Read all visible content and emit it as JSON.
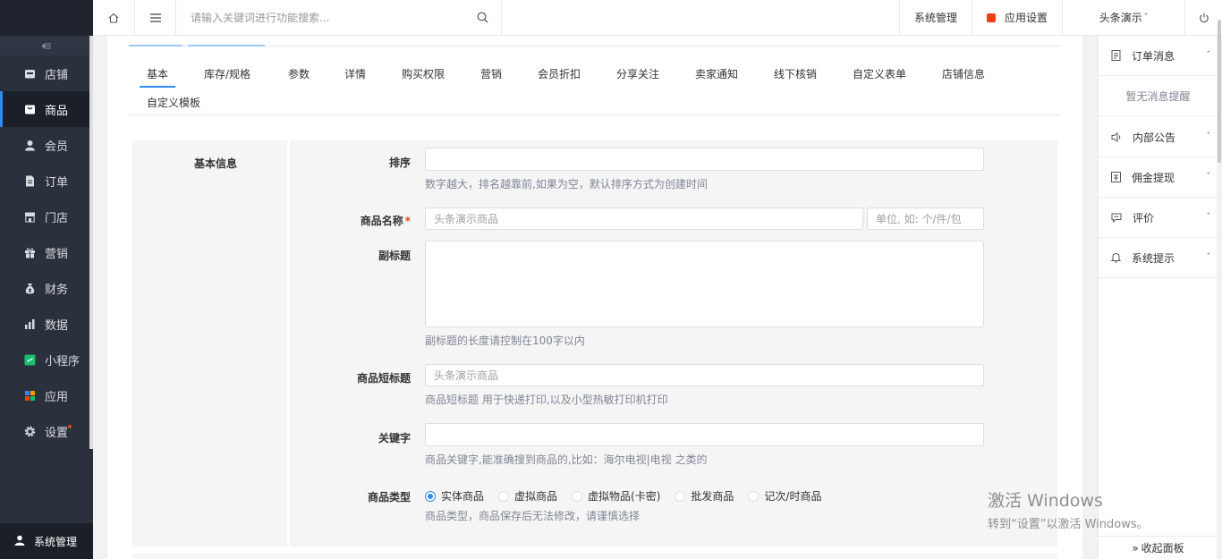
{
  "sidebar": {
    "items": [
      {
        "label": "店铺",
        "icon": "shop-icon"
      },
      {
        "label": "商品",
        "icon": "goods-icon"
      },
      {
        "label": "会员",
        "icon": "user-icon"
      },
      {
        "label": "订单",
        "icon": "order-icon"
      },
      {
        "label": "门店",
        "icon": "store-icon"
      },
      {
        "label": "营销",
        "icon": "gift-icon"
      },
      {
        "label": "财务",
        "icon": "money-bag-icon"
      },
      {
        "label": "数据",
        "icon": "bar-chart-icon"
      },
      {
        "label": "小程序",
        "icon": "miniprogram-icon"
      },
      {
        "label": "应用",
        "icon": "apps-icon"
      },
      {
        "label": "设置",
        "icon": "gear-icon"
      }
    ],
    "active_index": 1,
    "footer_label": "系统管理"
  },
  "topbar": {
    "search_placeholder": "请输入关键词进行功能搜索...",
    "system_label": "系统管理",
    "app_settings_label": "应用设置",
    "user_label": "头条演示"
  },
  "tabs": [
    "基本",
    "库存/规格",
    "参数",
    "详情",
    "购买权限",
    "营销",
    "会员折扣",
    "分享关注",
    "卖家通知",
    "线下核销",
    "自定义表单",
    "店铺信息",
    "自定义模板"
  ],
  "form": {
    "section_title": "基本信息",
    "sort": {
      "label": "排序",
      "value": "",
      "hint": "数字越大，排名越靠前,如果为空，默认排序方式为创建时间"
    },
    "name": {
      "label": "商品名称",
      "required_mark": "*",
      "placeholder": "头条演示商品",
      "unit_placeholder": "单位, 如: 个/件/包"
    },
    "subtitle": {
      "label": "副标题",
      "value": "",
      "hint": "副标题的长度请控制在100字以内"
    },
    "short_title": {
      "label": "商品短标题",
      "placeholder": "头条演示商品",
      "hint": "商品短标题 用于快递打印,以及小型热敏打印机打印"
    },
    "keywords": {
      "label": "关键字",
      "value": "",
      "hint": "商品关键字,能准确搜到商品的,比如：海尔电视|电视 之类的"
    },
    "type": {
      "label": "商品类型",
      "options": [
        "实体商品",
        "虚拟商品",
        "虚拟物品(卡密)",
        "批发商品",
        "记次/时商品"
      ],
      "selected_index": 0,
      "hint": "商品类型，商品保存后无法修改，请谨慎选择"
    }
  },
  "rpanel": {
    "order_msg": "订单消息",
    "empty_msg": "暂无消息提醒",
    "notice": "内部公告",
    "withdraw": "佣金提现",
    "review": "评价",
    "system_tip": "系统提示",
    "collapse": "收起面板"
  },
  "watermark": {
    "line1": "激活 Windows",
    "line2": "转到“设置”以激活 Windows。"
  }
}
